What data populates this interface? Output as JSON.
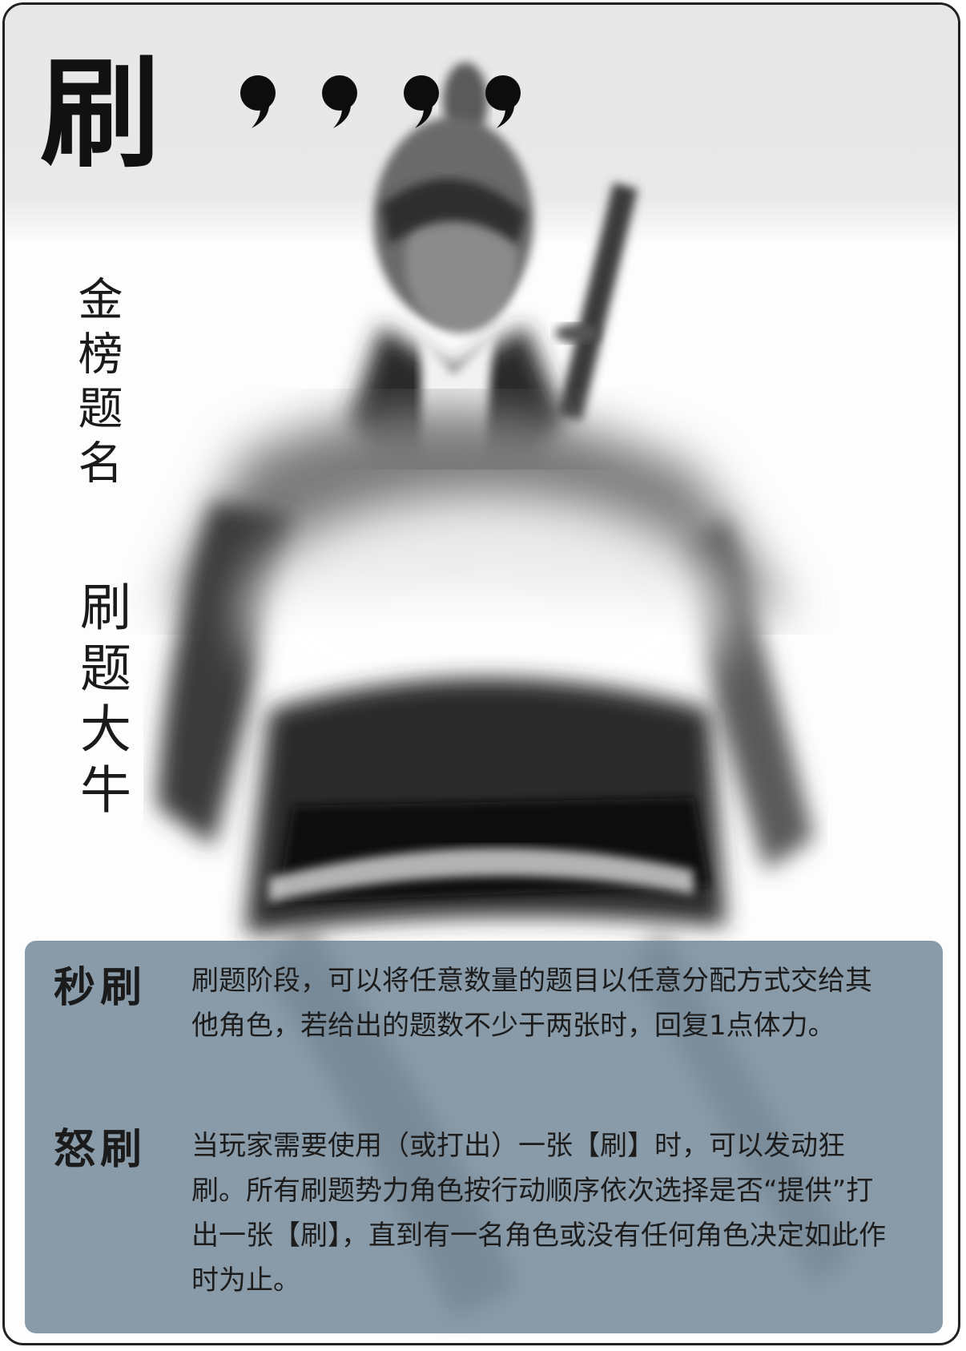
{
  "card": {
    "name": "刷",
    "hp": 4,
    "hp_icon": "ink-drop-icon",
    "title": "金榜题名",
    "hero": "刷题大牛"
  },
  "skills": [
    {
      "name": "秒刷",
      "description": "刷题阶段，可以将任意数量的题目以任意分配方式交给其他角色，若给出的题数不少于两张时，回复1点体力。"
    },
    {
      "name": "怒刷",
      "description": "当玩家需要使用（或打出）一张【刷】时，可以发动狂刷。所有刷题势力角色按行动顺序依次选择是否“提供”打出一张【刷】，直到有一名角色或没有任何角色决定如此作时为止。"
    }
  ],
  "colors": {
    "panel": "#6f8596",
    "ink": "#111111",
    "band": "#e7e7e7"
  }
}
